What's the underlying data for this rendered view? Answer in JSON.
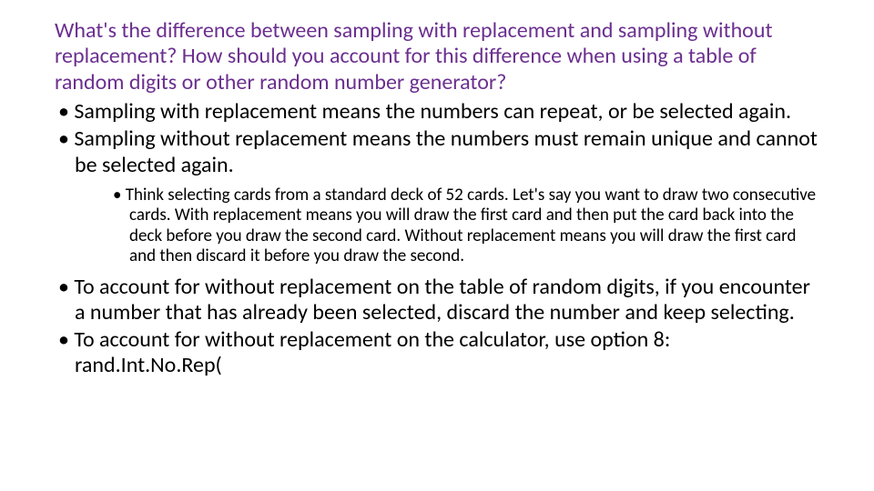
{
  "question": "What's the difference between sampling with replacement and sampling without replacement?  How should you account for this difference when using a table of random digits or other random number generator?",
  "bullets": {
    "b1": "Sampling with replacement means the numbers can repeat, or be selected again.",
    "b2": "Sampling without replacement means the numbers must remain unique and cannot be selected again.",
    "sub1": "Think selecting cards from a standard deck of 52 cards.  Let's say you want to draw two consecutive cards.  With replacement means you will draw the first card and then put the card back into the deck before you draw the second card.  Without replacement means you will draw the first card and then discard it before you draw the second.",
    "b3": "To account for without replacement on the table of random digits, if you encounter a number that has already been selected, discard the number and keep selecting.",
    "b4": "To account for without replacement on the calculator, use option 8: rand.Int.No.Rep("
  }
}
